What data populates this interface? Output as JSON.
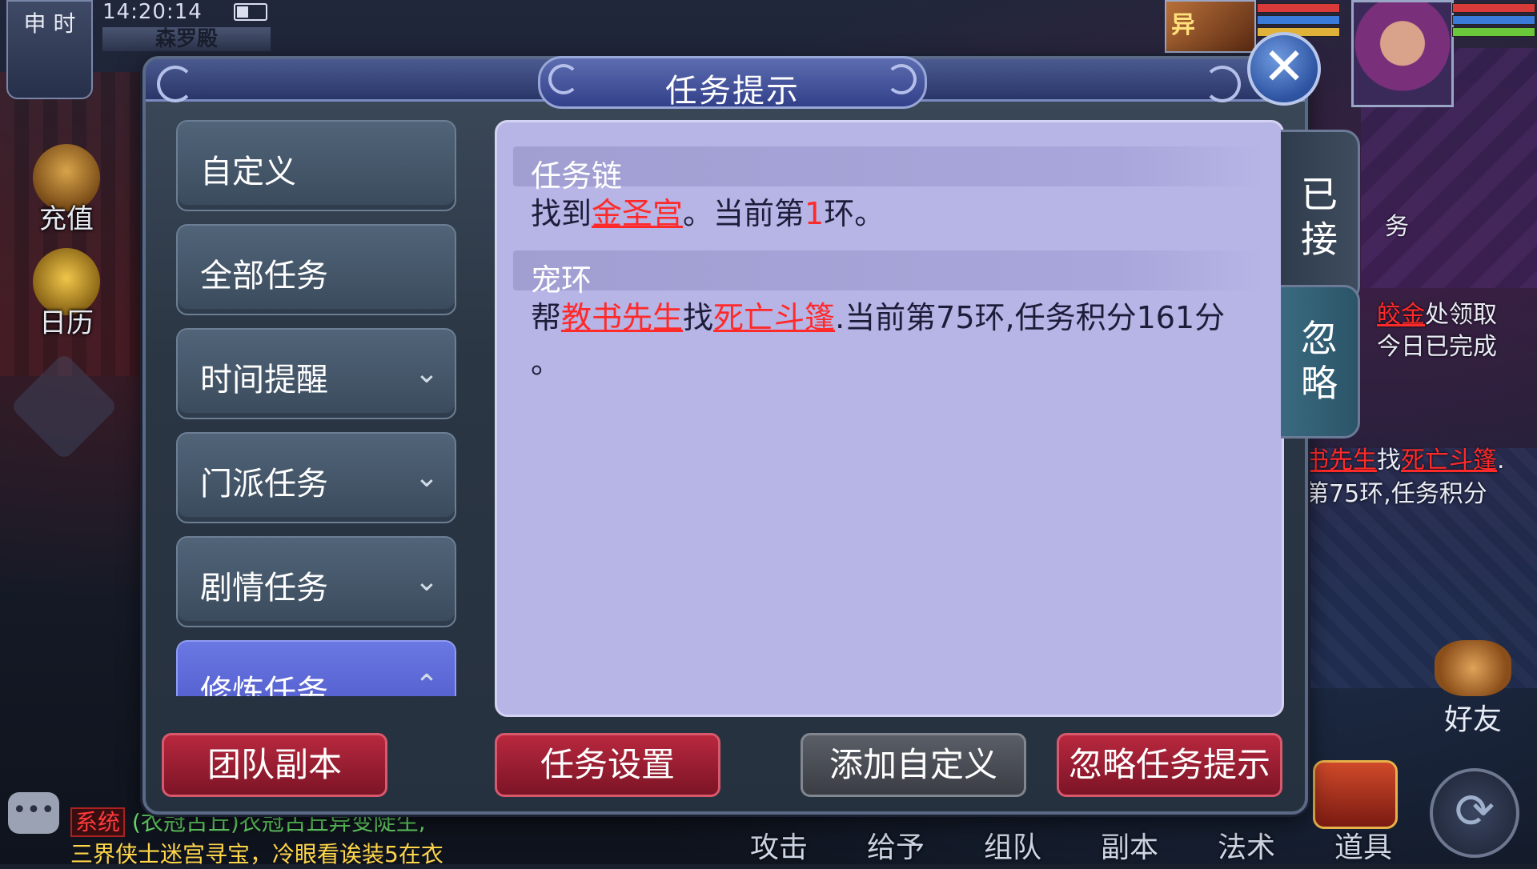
{
  "hud": {
    "shi_label": "申 时",
    "time": "14:20:14",
    "map_name": "森罗殿"
  },
  "sidebar_left": {
    "recharge": "充值",
    "calendar": "日历"
  },
  "party": {
    "member_label": "异"
  },
  "dialog": {
    "title": "任务提示",
    "close_symbol": "✕",
    "categories": [
      {
        "label": "自定义",
        "chevron": ""
      },
      {
        "label": "全部任务",
        "chevron": ""
      },
      {
        "label": "时间提醒",
        "chevron": "⌄"
      },
      {
        "label": "门派任务",
        "chevron": "⌄"
      },
      {
        "label": "剧情任务",
        "chevron": "⌄"
      },
      {
        "label": "修炼任务",
        "chevron": "⌃"
      }
    ],
    "sections": [
      {
        "header": "任务链",
        "body": {
          "pre": "找到",
          "link1": "金圣宫",
          "mid": "。当前第",
          "num": "1",
          "post": "环。"
        }
      },
      {
        "header": "宠环",
        "body": {
          "pre": "帮",
          "link1": "教书先生",
          "mid1": "找",
          "link2": "死亡斗篷",
          "post": ".当前第75环,任务积分161分",
          "tail": "。"
        }
      }
    ],
    "tabs": {
      "accepted": [
        "已",
        "接"
      ],
      "ignored": [
        "忽",
        "略"
      ]
    },
    "buttons": {
      "team_dungeon": "团队副本",
      "task_settings": "任务设置",
      "add_custom": "添加自定义",
      "ignore_prompt": "忽略任务提示"
    }
  },
  "right_panel": {
    "line1_link": "皎金",
    "line1_rest": "处领取",
    "line2": "今日已完成",
    "line3_link1": "书先生",
    "line3_mid": "找",
    "line3_link2": "死亡斗篷",
    "line3_end": ".",
    "line4": "第75环,任务积分",
    "partial_char": "务"
  },
  "friends": "好友",
  "refresh_symbol": "⟳",
  "chat": {
    "icon": "•••",
    "sys_tag": "系统",
    "line1_green": "(衣冠古丘)",
    "line1_text": "衣冠古丘异变陡生,",
    "line2": "三界侠士迷宫寻宝，冷眼看诶装5在衣"
  },
  "bottom_menu": [
    "攻击",
    "给予",
    "组队",
    "副本",
    "法术",
    "道具"
  ],
  "colors": {
    "accent_red": "#ff2a2a",
    "active_tab": "#5a66d4",
    "content_bg": "#b7b4e6",
    "button_red": "#9c1d32"
  }
}
